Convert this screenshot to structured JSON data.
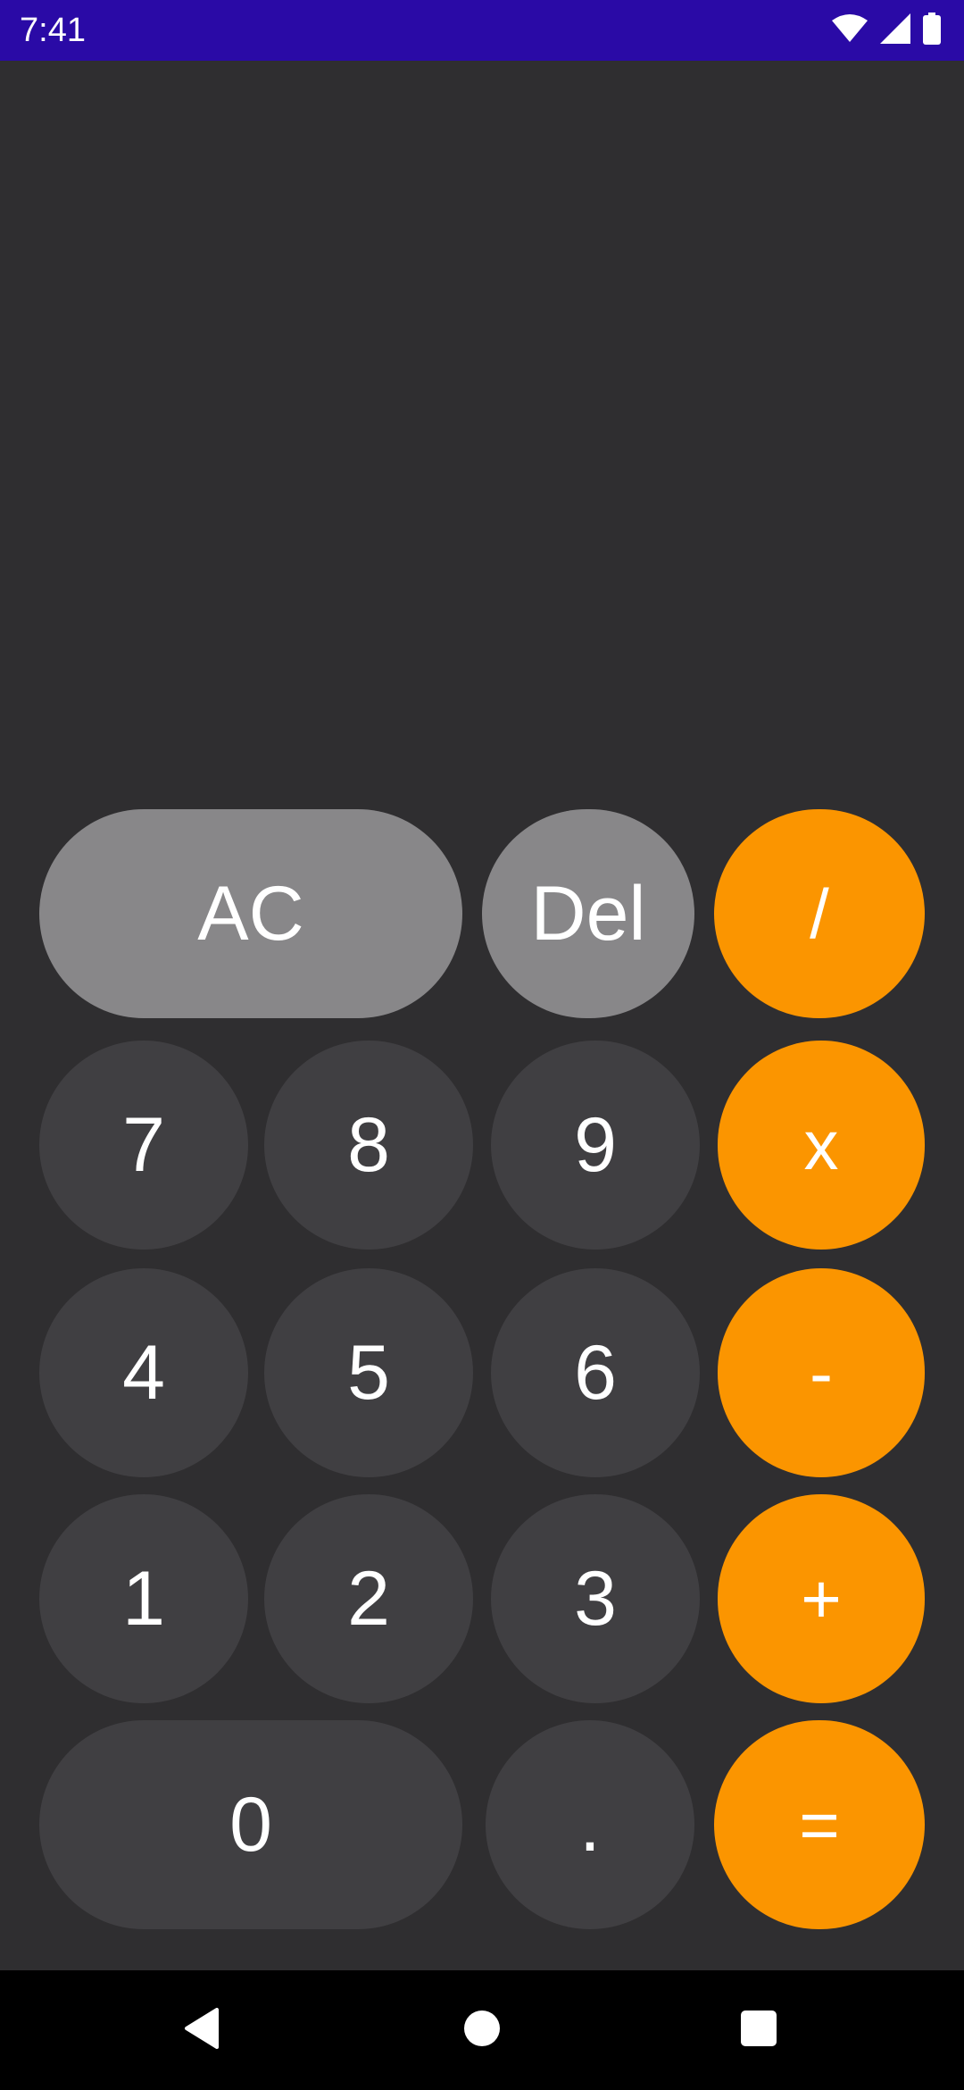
{
  "status_bar": {
    "time": "7:41",
    "icons": [
      "wifi-icon",
      "signal-icon",
      "battery-icon"
    ]
  },
  "calculator": {
    "display": "",
    "keys": {
      "ac": "AC",
      "del": "Del",
      "divide": "/",
      "seven": "7",
      "eight": "8",
      "nine": "9",
      "multiply": "x",
      "four": "4",
      "five": "5",
      "six": "6",
      "minus": "-",
      "one": "1",
      "two": "2",
      "three": "3",
      "plus": "+",
      "zero": "0",
      "dot": ".",
      "equals": "="
    }
  },
  "nav_bar": {
    "icons": [
      "back-icon",
      "home-icon",
      "recents-icon"
    ]
  },
  "colors": {
    "status_bar": "#2a0aa6",
    "background": "#2f2e30",
    "light_key": "#888789",
    "dark_key": "#403f42",
    "operator_key": "#fb9500",
    "nav_bar": "#000000"
  }
}
